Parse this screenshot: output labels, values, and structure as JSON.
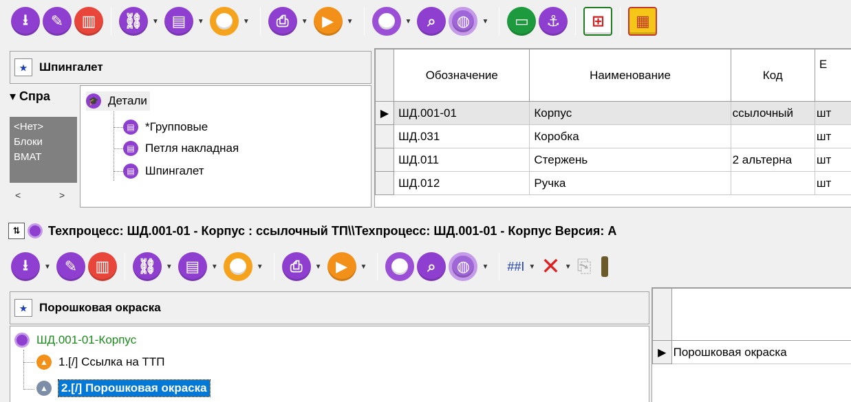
{
  "top_tree_panel": {
    "title": "Шпингалет",
    "ref_section": {
      "header": "Спра",
      "items": [
        "<Нет>",
        "Блоки",
        "ВМАТ"
      ],
      "scroll_left": "<",
      "scroll_right": ">"
    },
    "root": "Детали",
    "children": [
      "*Групповые",
      "Петля накладная",
      "Шпингалет"
    ]
  },
  "parts_grid": {
    "columns": [
      "Обозначение",
      "Наименование",
      "Код",
      "Е"
    ],
    "rows": [
      {
        "designation": "ШД.001-01",
        "name": "Корпус",
        "code": "ссылочный",
        "unit": "шт"
      },
      {
        "designation": "ШД.031",
        "name": "Коробка",
        "code": "",
        "unit": "шт"
      },
      {
        "designation": "ШД.011",
        "name": "Стержень",
        "code": "2 альтерна",
        "unit": "шт"
      },
      {
        "designation": "ШД.012",
        "name": "Ручка",
        "code": "",
        "unit": "шт"
      }
    ]
  },
  "status_line": {
    "text": "Техпроцесс: ШД.001-01 - Корпус : ссылочный ТП\\\\Техпроцесс: ШД.001-01 - Корпус Версия: А"
  },
  "bottom_toolbar": {
    "numbering_label": "##I"
  },
  "bottom_tree_panel": {
    "title": "Порошковая окраска",
    "root": "ШД.001-01-Корпус",
    "children": [
      "1.[/] Ссылка на ТТП",
      "2.[/] Порошковая окраска"
    ],
    "selected_index": 1
  },
  "ops_grid": {
    "rows": [
      "Порошковая окраска"
    ]
  },
  "colors": {
    "selection": "#0078d7",
    "root_node_text": "#1a8a1a",
    "purple": "#8e3fd0",
    "orange": "#f39019",
    "red": "#e8463a",
    "green": "#1e9a3e"
  }
}
